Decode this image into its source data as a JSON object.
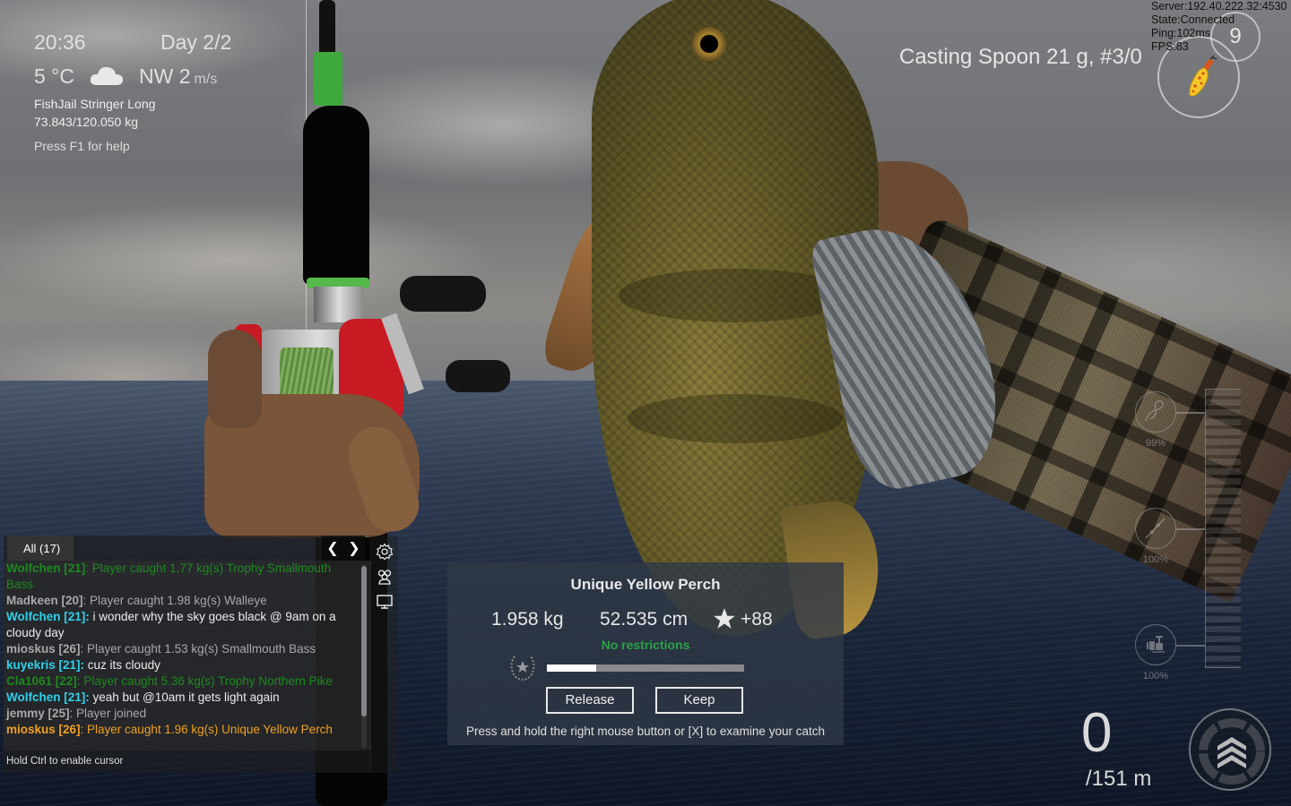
{
  "hud": {
    "time": "20:36",
    "day": "Day 2/2",
    "temperature": "5 °C",
    "weather_icon": "cloud-icon",
    "wind": "NW 2",
    "wind_unit": "m/s",
    "stringer_name": "FishJail Stringer Long",
    "stringer_weight": "73.843/120.050 kg",
    "help_hint": "Press F1 for help"
  },
  "lure": {
    "title": "Casting Spoon 21 g, #3/0",
    "count": "9",
    "icon": "spoon-lure-icon"
  },
  "network": {
    "server": "Server:192.40.222.32:4530",
    "state": "State:Connected",
    "ping": "Ping:102ms",
    "fps": "FPS:83"
  },
  "chat": {
    "tab_label": "All (17)",
    "prev_icon": "chevron-left-icon",
    "next_icon": "chevron-right-icon",
    "side_icons": [
      "gear-icon",
      "users-icon",
      "monitor-icon"
    ],
    "messages": [
      {
        "name": "Wolfchen [21]",
        "text": ": Player caught 1.77 kg(s) Trophy Smallmouth Bass",
        "name_color": "#1e8a1e",
        "text_color": "#1e8a1e"
      },
      {
        "name": "Madkeen [20]",
        "text": ": Player caught 1.98 kg(s) Walleye",
        "name_color": "#a8a8a8",
        "text_color": "#a8a8a8"
      },
      {
        "name": "Wolfchen [21]:",
        "text": " i wonder why the sky goes black @ 9am on a cloudy day",
        "name_color": "#2fd0e8",
        "text_color": "#ececec"
      },
      {
        "name": "mioskus [26]",
        "text": ": Player caught 1.53 kg(s) Smallmouth Bass",
        "name_color": "#a8a8a8",
        "text_color": "#a8a8a8"
      },
      {
        "name": "kuyekris [21]:",
        "text": " cuz its cloudy",
        "name_color": "#2fd0e8",
        "text_color": "#ececec"
      },
      {
        "name": "Cla1061 [22]",
        "text": ": Player caught 5.36 kg(s) Trophy Northern Pike",
        "name_color": "#1e8a1e",
        "text_color": "#1e8a1e"
      },
      {
        "name": "Wolfchen [21]:",
        "text": " yeah but @10am it gets light again",
        "name_color": "#2fd0e8",
        "text_color": "#ececec"
      },
      {
        "name": "jemmy [25]",
        "text": ": Player joined",
        "name_color": "#a8a8a8",
        "text_color": "#a8a8a8"
      },
      {
        "name": "mioskus [26]",
        "text": ": Player caught 1.96 kg(s) Unique Yellow Perch",
        "name_color": "#f0a020",
        "text_color": "#f0a020"
      }
    ],
    "footer": "Hold Ctrl to enable cursor"
  },
  "catch": {
    "title": "Unique Yellow Perch",
    "weight": "1.958 kg",
    "length": "52.535 cm",
    "score": "+88",
    "restriction": "No restrictions",
    "restriction_color": "#2aa148",
    "progress_fraction": 0.25,
    "release_label": "Release",
    "keep_label": "Keep",
    "hint": "Press and hold the right mouse button or [X] to examine your catch"
  },
  "gauges": [
    {
      "icon": "line-icon",
      "percent": "99%"
    },
    {
      "icon": "rod-icon",
      "percent": "100%"
    },
    {
      "icon": "reel-icon",
      "percent": "100%"
    }
  ],
  "distance": {
    "current": "0",
    "total": "/151 m",
    "reel_button_icon": "chevrons-up-icon"
  }
}
